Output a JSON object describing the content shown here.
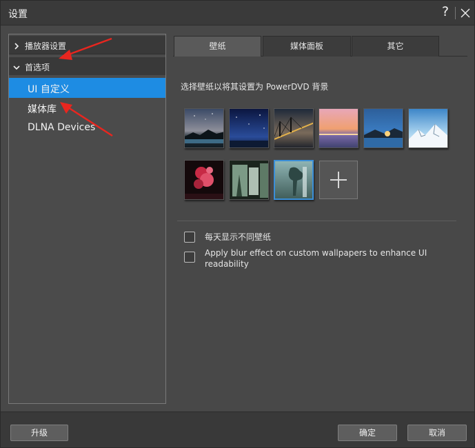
{
  "window": {
    "title": "设置"
  },
  "sidebar": {
    "groups": [
      {
        "label": "播放器设置",
        "expanded": false,
        "children": []
      },
      {
        "label": "首选项",
        "expanded": true,
        "children": [
          {
            "label": "UI 自定义",
            "selected": true
          },
          {
            "label": "媒体库",
            "selected": false
          },
          {
            "label": "DLNA Devices",
            "selected": false
          }
        ]
      }
    ]
  },
  "tabs": [
    {
      "label": "壁纸",
      "active": true
    },
    {
      "label": "媒体面板",
      "active": false
    },
    {
      "label": "其它",
      "active": false
    }
  ],
  "wallpaper": {
    "caption": "选择壁纸以将其设置为 PowerDVD 背景",
    "thumbnails": [
      {
        "name": "starry-sky-lake",
        "selected": false
      },
      {
        "name": "blue-night-sky",
        "selected": false
      },
      {
        "name": "bridge-at-dusk",
        "selected": false
      },
      {
        "name": "pink-sunset-sea",
        "selected": false
      },
      {
        "name": "sunrise-over-water",
        "selected": false
      },
      {
        "name": "snowy-mountains",
        "selected": false
      },
      {
        "name": "red-coral",
        "selected": false
      },
      {
        "name": "green-misty-forest",
        "selected": false
      },
      {
        "name": "misty-waterfall-tree",
        "selected": true
      }
    ],
    "add_icon": "plus-icon"
  },
  "options": [
    {
      "label": "每天显示不同壁纸",
      "checked": false
    },
    {
      "label_line1": "Apply blur effect on custom wallpapers to enhance UI",
      "label_line2": "readability",
      "checked": false
    }
  ],
  "footer": {
    "upgrade_label": "升级",
    "ok_label": "确定",
    "cancel_label": "取消"
  },
  "annotations": {
    "arrow_color": "#e8261f"
  },
  "icons": {
    "help": "?",
    "close": "close-icon",
    "collapsed": "chevron-right-icon",
    "expanded": "chevron-down-icon"
  }
}
